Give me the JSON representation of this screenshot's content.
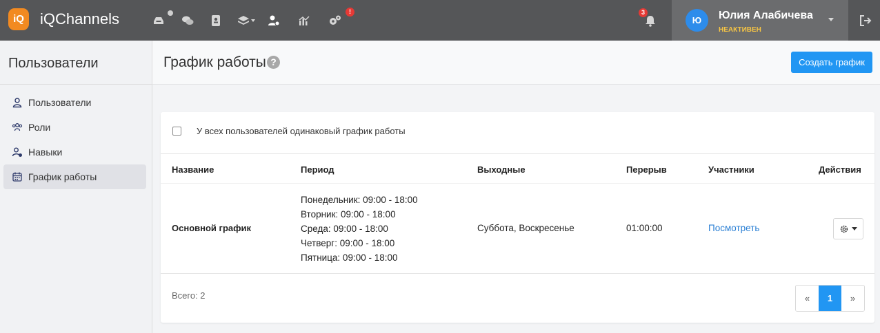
{
  "app": {
    "logo": "iQ",
    "name": "iQChannels"
  },
  "topnav": {
    "notification_count": "3",
    "settings_alert": "!",
    "user": {
      "initial": "Ю",
      "name": "Юлия Алабичева",
      "status": "НЕАКТИВЕН"
    }
  },
  "sidebar": {
    "title": "Пользователи",
    "items": [
      {
        "label": "Пользователи",
        "icon": "user-icon"
      },
      {
        "label": "Роли",
        "icon": "users-group-icon"
      },
      {
        "label": "Навыки",
        "icon": "user-skill-icon"
      },
      {
        "label": "График работы",
        "icon": "calendar-icon",
        "active": true
      }
    ]
  },
  "page": {
    "title": "График работы",
    "help": "?",
    "create_button": "Создать график"
  },
  "card": {
    "checkbox_label": "У всех пользователей одинаковый график работы",
    "columns": [
      "Название",
      "Период",
      "Выходные",
      "Перерыв",
      "Участники",
      "Действия"
    ],
    "rows": [
      {
        "name": "Основной график",
        "period": [
          "Понедельник: 09:00 - 18:00",
          "Вторник: 09:00 - 18:00",
          "Среда: 09:00 - 18:00",
          "Четверг: 09:00 - 18:00",
          "Пятница: 09:00 - 18:00"
        ],
        "days_off": "Суббота, Воскресенье",
        "break": "01:00:00",
        "members_link": "Посмотреть"
      }
    ],
    "total": "Всего: 2",
    "pagination": {
      "prev": "«",
      "current": "1",
      "next": "»"
    }
  },
  "colors": {
    "topbar": "#555658",
    "accent": "#2196f3",
    "logo": "#f28a21",
    "status": "#f7c544"
  }
}
